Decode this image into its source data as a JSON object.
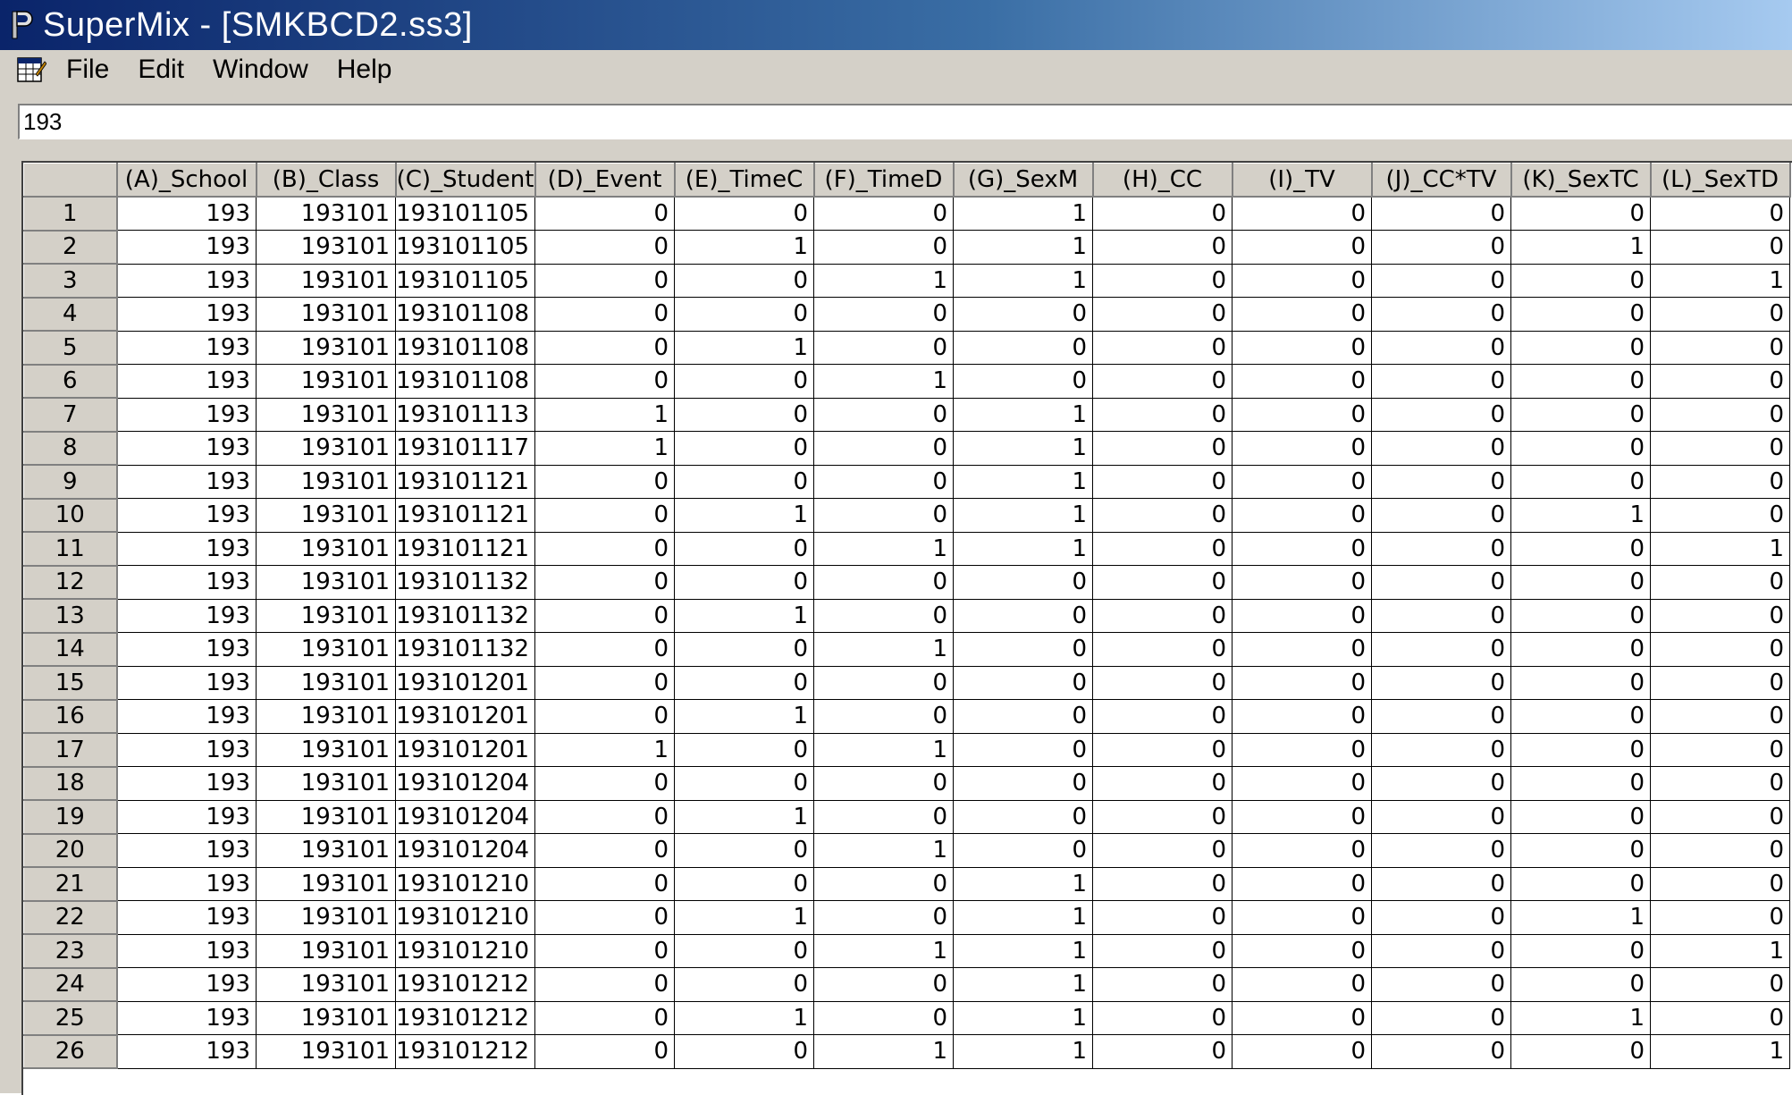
{
  "window": {
    "title": "SuperMix - [SMKBCD2.ss3]",
    "app_icon": "supermix-p-icon"
  },
  "menubar": {
    "doc_icon": "spreadsheet-document-icon",
    "items": [
      "File",
      "Edit",
      "Window",
      "Help"
    ]
  },
  "cell_input": {
    "value": "193"
  },
  "grid": {
    "columns": [
      "(A)_School",
      "(B)_Class",
      "(C)_Student",
      "(D)_Event",
      "(E)_TimeC",
      "(F)_TimeD",
      "(G)_SexM",
      "(H)_CC",
      "(I)_TV",
      "(J)_CC*TV",
      "(K)_SexTC",
      "(L)_SexTD"
    ],
    "rows": [
      {
        "n": "1",
        "cells": [
          "193",
          "193101",
          "193101105",
          "0",
          "0",
          "0",
          "1",
          "0",
          "0",
          "0",
          "0",
          "0"
        ]
      },
      {
        "n": "2",
        "cells": [
          "193",
          "193101",
          "193101105",
          "0",
          "1",
          "0",
          "1",
          "0",
          "0",
          "0",
          "1",
          "0"
        ]
      },
      {
        "n": "3",
        "cells": [
          "193",
          "193101",
          "193101105",
          "0",
          "0",
          "1",
          "1",
          "0",
          "0",
          "0",
          "0",
          "1"
        ]
      },
      {
        "n": "4",
        "cells": [
          "193",
          "193101",
          "193101108",
          "0",
          "0",
          "0",
          "0",
          "0",
          "0",
          "0",
          "0",
          "0"
        ]
      },
      {
        "n": "5",
        "cells": [
          "193",
          "193101",
          "193101108",
          "0",
          "1",
          "0",
          "0",
          "0",
          "0",
          "0",
          "0",
          "0"
        ]
      },
      {
        "n": "6",
        "cells": [
          "193",
          "193101",
          "193101108",
          "0",
          "0",
          "1",
          "0",
          "0",
          "0",
          "0",
          "0",
          "0"
        ]
      },
      {
        "n": "7",
        "cells": [
          "193",
          "193101",
          "193101113",
          "1",
          "0",
          "0",
          "1",
          "0",
          "0",
          "0",
          "0",
          "0"
        ]
      },
      {
        "n": "8",
        "cells": [
          "193",
          "193101",
          "193101117",
          "1",
          "0",
          "0",
          "1",
          "0",
          "0",
          "0",
          "0",
          "0"
        ]
      },
      {
        "n": "9",
        "cells": [
          "193",
          "193101",
          "193101121",
          "0",
          "0",
          "0",
          "1",
          "0",
          "0",
          "0",
          "0",
          "0"
        ]
      },
      {
        "n": "10",
        "cells": [
          "193",
          "193101",
          "193101121",
          "0",
          "1",
          "0",
          "1",
          "0",
          "0",
          "0",
          "1",
          "0"
        ]
      },
      {
        "n": "11",
        "cells": [
          "193",
          "193101",
          "193101121",
          "0",
          "0",
          "1",
          "1",
          "0",
          "0",
          "0",
          "0",
          "1"
        ]
      },
      {
        "n": "12",
        "cells": [
          "193",
          "193101",
          "193101132",
          "0",
          "0",
          "0",
          "0",
          "0",
          "0",
          "0",
          "0",
          "0"
        ]
      },
      {
        "n": "13",
        "cells": [
          "193",
          "193101",
          "193101132",
          "0",
          "1",
          "0",
          "0",
          "0",
          "0",
          "0",
          "0",
          "0"
        ]
      },
      {
        "n": "14",
        "cells": [
          "193",
          "193101",
          "193101132",
          "0",
          "0",
          "1",
          "0",
          "0",
          "0",
          "0",
          "0",
          "0"
        ]
      },
      {
        "n": "15",
        "cells": [
          "193",
          "193101",
          "193101201",
          "0",
          "0",
          "0",
          "0",
          "0",
          "0",
          "0",
          "0",
          "0"
        ]
      },
      {
        "n": "16",
        "cells": [
          "193",
          "193101",
          "193101201",
          "0",
          "1",
          "0",
          "0",
          "0",
          "0",
          "0",
          "0",
          "0"
        ]
      },
      {
        "n": "17",
        "cells": [
          "193",
          "193101",
          "193101201",
          "1",
          "0",
          "1",
          "0",
          "0",
          "0",
          "0",
          "0",
          "0"
        ]
      },
      {
        "n": "18",
        "cells": [
          "193",
          "193101",
          "193101204",
          "0",
          "0",
          "0",
          "0",
          "0",
          "0",
          "0",
          "0",
          "0"
        ]
      },
      {
        "n": "19",
        "cells": [
          "193",
          "193101",
          "193101204",
          "0",
          "1",
          "0",
          "0",
          "0",
          "0",
          "0",
          "0",
          "0"
        ]
      },
      {
        "n": "20",
        "cells": [
          "193",
          "193101",
          "193101204",
          "0",
          "0",
          "1",
          "0",
          "0",
          "0",
          "0",
          "0",
          "0"
        ]
      },
      {
        "n": "21",
        "cells": [
          "193",
          "193101",
          "193101210",
          "0",
          "0",
          "0",
          "1",
          "0",
          "0",
          "0",
          "0",
          "0"
        ]
      },
      {
        "n": "22",
        "cells": [
          "193",
          "193101",
          "193101210",
          "0",
          "1",
          "0",
          "1",
          "0",
          "0",
          "0",
          "1",
          "0"
        ]
      },
      {
        "n": "23",
        "cells": [
          "193",
          "193101",
          "193101210",
          "0",
          "0",
          "1",
          "1",
          "0",
          "0",
          "0",
          "0",
          "1"
        ]
      },
      {
        "n": "24",
        "cells": [
          "193",
          "193101",
          "193101212",
          "0",
          "0",
          "0",
          "1",
          "0",
          "0",
          "0",
          "0",
          "0"
        ]
      },
      {
        "n": "25",
        "cells": [
          "193",
          "193101",
          "193101212",
          "0",
          "1",
          "0",
          "1",
          "0",
          "0",
          "0",
          "1",
          "0"
        ]
      },
      {
        "n": "26",
        "cells": [
          "193",
          "193101",
          "193101212",
          "0",
          "0",
          "1",
          "1",
          "0",
          "0",
          "0",
          "0",
          "1"
        ]
      }
    ]
  },
  "colors": {
    "title_bar_start": "#0a246a",
    "title_bar_end": "#a6caf0",
    "chrome": "#d4d0c8"
  }
}
